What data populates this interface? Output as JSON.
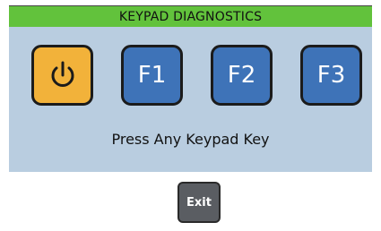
{
  "title": "KEYPAD DIAGNOSTICS",
  "keys": {
    "power": {
      "icon": "power-icon"
    },
    "f1": {
      "label": "F1"
    },
    "f2": {
      "label": "F2"
    },
    "f3": {
      "label": "F3"
    }
  },
  "prompt": "Press Any Keypad Key",
  "exit_label": "Exit",
  "colors": {
    "title_bar": "#62c23c",
    "panel": "#b9cde0",
    "power_key": "#f2b23a",
    "function_key": "#3e73b8",
    "exit_button": "#5a5d62"
  }
}
